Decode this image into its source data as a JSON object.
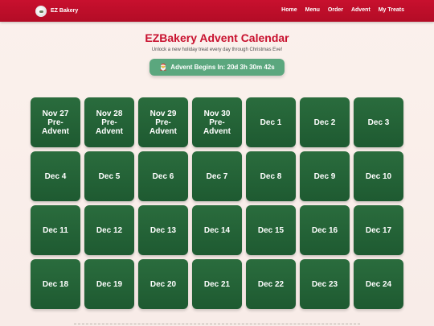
{
  "navbar": {
    "brand": "EZ Bakery",
    "links": [
      "Home",
      "Menu",
      "Order",
      "Advent",
      "My Treats"
    ],
    "color": "#c8102e"
  },
  "page": {
    "title": "EZBakery Advent Calendar",
    "subtitle": "Unlock a new holiday treat every day through Christmas Eve!",
    "countdown_icon": "santa-icon",
    "countdown_text": "Advent Begins In: 20d 3h 30m 42s",
    "countdown_color": "#5ba77e"
  },
  "calendar": {
    "door_color": "#236437",
    "doors": [
      "Nov 27\nPre-\nAdvent",
      "Nov 28\nPre-\nAdvent",
      "Nov 29\nPre-\nAdvent",
      "Nov 30\nPre-\nAdvent",
      "Dec 1",
      "Dec 2",
      "Dec 3",
      "Dec 4",
      "Dec 5",
      "Dec 6",
      "Dec 7",
      "Dec 8",
      "Dec 9",
      "Dec 10",
      "Dec 11",
      "Dec 12",
      "Dec 13",
      "Dec 14",
      "Dec 15",
      "Dec 16",
      "Dec 17",
      "Dec 18",
      "Dec 19",
      "Dec 20",
      "Dec 21",
      "Dec 22",
      "Dec 23",
      "Dec 24"
    ]
  }
}
